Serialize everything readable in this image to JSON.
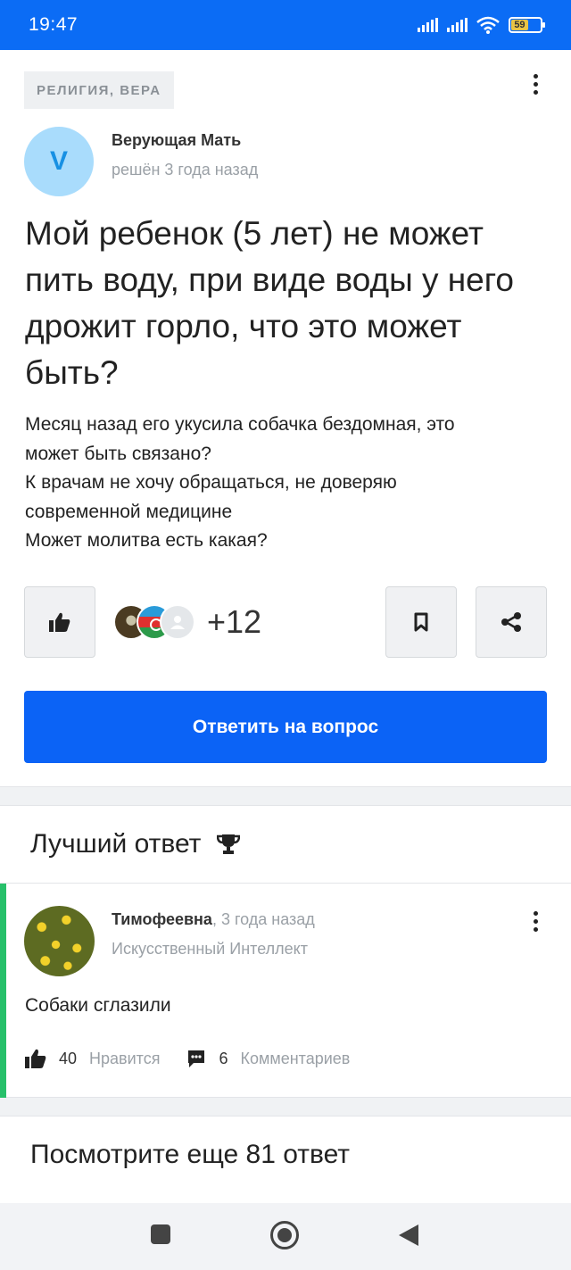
{
  "status_bar": {
    "time": "19:47",
    "battery": "59"
  },
  "question": {
    "category": "РЕЛИГИЯ, ВЕРА",
    "avatar_letter": "V",
    "author": "Верующая Мать",
    "meta": "решён 3 года назад",
    "title": "Мой ребенок (5 лет) не может пить воду, при виде воды у него дрожит горло, что это может быть?",
    "body_lines": [
      "Месяц назад его укусила собачка бездомная, это",
      "может быть связано?",
      "К врачам не хочу обращаться, не доверяю",
      "современной медицине",
      "Может молитва есть какая?"
    ],
    "voters_more": "+12",
    "answer_button": "Ответить на вопрос"
  },
  "best_answer": {
    "header": "Лучший ответ",
    "author": "Тимофеевна",
    "time": ", 3 года назад",
    "role": "Искусственный Интеллект",
    "text": "Собаки сглазили",
    "likes_count": "40",
    "likes_label": "Нравится",
    "comments_count": "6",
    "comments_label": "Комментариев"
  },
  "more_answers": {
    "title": "Посмотрите еще 81 ответ"
  },
  "icons": {
    "like": "thumbs-up-icon",
    "bookmark": "bookmark-icon",
    "share": "share-icon",
    "trophy": "trophy-icon",
    "comment": "comment-icon",
    "menu": "more-vertical-icon"
  },
  "colors": {
    "brand_blue": "#0b63f6",
    "status_bar": "#0b6cf5",
    "best_accent": "#27c06a",
    "muted_text": "#9aa0a6"
  }
}
